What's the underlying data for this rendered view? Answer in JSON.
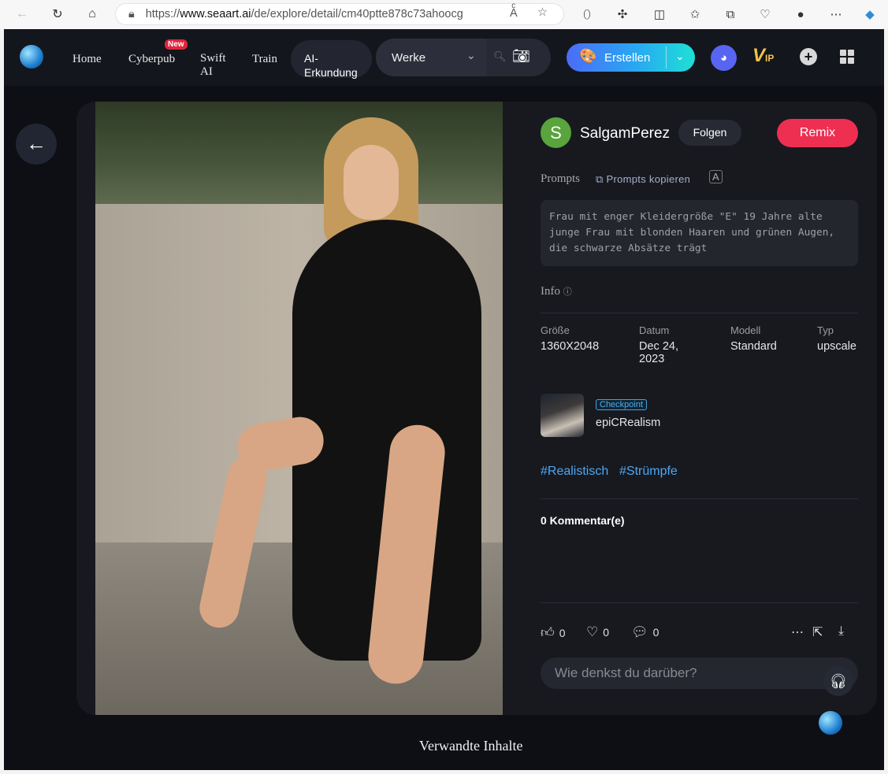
{
  "browser": {
    "url_prefix": "https://",
    "url_domain": "www.seaart.ai",
    "url_path": "/de/explore/detail/cm40ptte878c73ahoocg"
  },
  "nav": {
    "home": "Home",
    "cyberpub": "Cyberpub",
    "new_badge": "New",
    "swift_line1": "Swift",
    "swift_line2": "AI",
    "train": "Train",
    "ai_explore_line1": "AI-",
    "ai_explore_line2": "Erkundung",
    "search_scope": "Werke",
    "create": "Erstellen",
    "vip": "V",
    "vip_sub": "IP"
  },
  "post": {
    "avatar_letter": "S",
    "username": "SalgamPerez",
    "follow": "Folgen",
    "remix": "Remix",
    "prompts_title": "Prompts",
    "copy_prompts": "Prompts kopieren",
    "translate_icon": "A",
    "prompt_text": "Frau mit enger Kleidergröße \"E\" 19 Jahre alte junge Frau mit blonden Haaren und grünen Augen, die schwarze Absätze trägt",
    "info_title": "Info",
    "meta": {
      "size_label": "Größe",
      "size_value": "1360X2048",
      "date_label": "Datum",
      "date_value_line1": "Dec 24,",
      "date_value_line2": "2023",
      "model_label": "Modell",
      "model_value": "Standard",
      "type_label": "Typ",
      "type_value": "upscale"
    },
    "model_badge": "Checkpoint",
    "model_name": "epiCRealism",
    "tags": [
      "#Realistisch",
      "#Strümpfe"
    ],
    "comments": "0 Kommentar(e)",
    "likes": "0",
    "favorites": "0",
    "comment_count": "0",
    "comment_placeholder": "Wie denkst du darüber?"
  },
  "related_title": "Verwandte Inhalte",
  "colors": {
    "accent_remix": "#ee2f52",
    "tag_blue": "#4ea7f2",
    "bg": "#0d0f14"
  }
}
